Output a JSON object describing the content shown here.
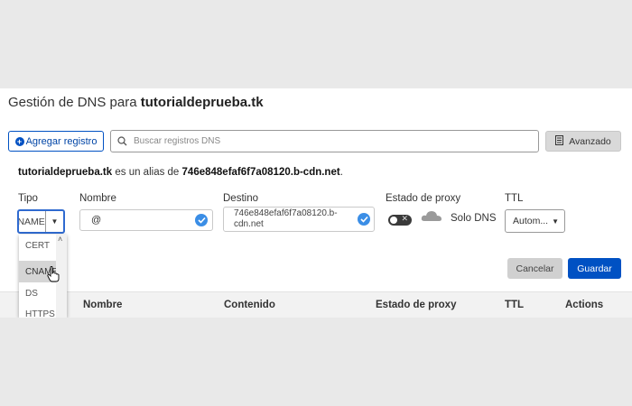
{
  "header": {
    "title_prefix": "Gestión de DNS para",
    "domain": "tutorialdeprueba.tk"
  },
  "toolbar": {
    "add_label": "Agregar registro",
    "search_placeholder": "Buscar registros DNS",
    "advanced_label": "Avanzado"
  },
  "alias": {
    "domain": "tutorialdeprueba.tk",
    "text": "es un alias de",
    "target": "746e848efaf6f7a08120.b-cdn.net",
    "suffix": "."
  },
  "form": {
    "tipo_label": "Tipo",
    "tipo_value": "CNAME",
    "nombre_label": "Nombre",
    "nombre_value": "@",
    "destino_label": "Destino",
    "destino_value_line1": "746e848efaf6f7a08120.b-",
    "destino_value_line2": "cdn.net",
    "proxy_label": "Estado de proxy",
    "proxy_status": "Solo DNS",
    "ttl_label": "TTL",
    "ttl_value": "Autom...",
    "cancel_label": "Cancelar",
    "save_label": "Guardar"
  },
  "dropdown": {
    "options": [
      "CERT",
      "CNAME",
      "DS",
      "HTTPS"
    ]
  },
  "table": {
    "columns": [
      "Nombre",
      "Contenido",
      "Estado de proxy",
      "TTL",
      "Actions"
    ]
  },
  "colors": {
    "accent": "#0051c3",
    "check": "#3b8ee6",
    "cloud": "#9a9a9a"
  }
}
